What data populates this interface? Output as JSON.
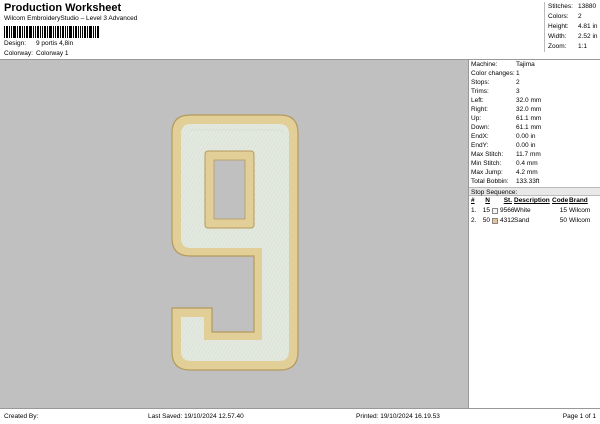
{
  "header": {
    "title": "Production Worksheet",
    "subtitle": "Wilcom EmbroideryStudio – Level 3 Advanced",
    "design_label": "Design:",
    "design_value": "9 portis 4,8in",
    "colorway_label": "Colorway:",
    "colorway_value": "Colorway 1"
  },
  "summary": [
    {
      "label": "Stitches:",
      "value": "13880"
    },
    {
      "label": "Colors:",
      "value": "2"
    },
    {
      "label": "Height:",
      "value": "4.81 in"
    },
    {
      "label": "Width:",
      "value": "2.52 in"
    },
    {
      "label": "Zoom:",
      "value": "1:1"
    }
  ],
  "properties": [
    {
      "label": "Machine:",
      "value": "Tajima"
    },
    {
      "label": "Color changes:",
      "value": "1"
    },
    {
      "label": "Stops:",
      "value": "2"
    },
    {
      "label": "Trims:",
      "value": "3"
    },
    {
      "label": "Left:",
      "value": "32.0 mm"
    },
    {
      "label": "Right:",
      "value": "32.0 mm"
    },
    {
      "label": "Up:",
      "value": "61.1 mm"
    },
    {
      "label": "Down:",
      "value": "61.1 mm"
    },
    {
      "label": "EndX:",
      "value": "0.00 in"
    },
    {
      "label": "EndY:",
      "value": "0.00 in"
    },
    {
      "label": "Max Stitch:",
      "value": "11.7 mm"
    },
    {
      "label": "Min Stitch:",
      "value": "0.4 mm"
    },
    {
      "label": "Max Jump:",
      "value": "4.2 mm"
    },
    {
      "label": "Total Bobbin:",
      "value": "133.33ft"
    }
  ],
  "stop_sequence": {
    "title": "Stop Sequence:",
    "headers": {
      "num": "#",
      "n": "N",
      "st": "St.",
      "desc": "Description",
      "code": "Code",
      "brand": "Brand"
    },
    "rows": [
      {
        "num": "1.",
        "n": "15",
        "color": "#f4f4f0",
        "st": "9566",
        "desc": "White",
        "code": "15",
        "brand": "Wilcom"
      },
      {
        "num": "2.",
        "n": "50",
        "color": "#e6c590",
        "st": "4312",
        "desc": "Sand",
        "code": "50",
        "brand": "Wilcom"
      }
    ]
  },
  "footer": {
    "created_by": "Created By:",
    "last_saved": "Last Saved: 19/10/2024 12.57.40",
    "printed": "Printed: 19/10/2024 16.19.53",
    "page": "Page 1 of 1"
  },
  "colors": {
    "canvas": "#c0c0c0",
    "fill_white": "#dfe6dc",
    "sand": "#e2cf98",
    "sand_edge": "#b49a5c"
  }
}
